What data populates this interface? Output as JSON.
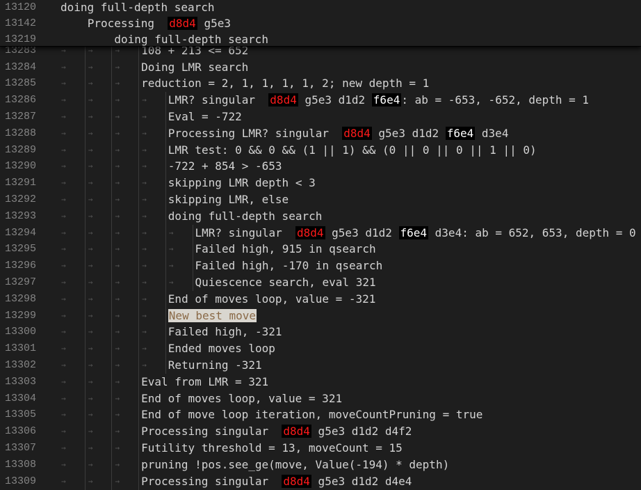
{
  "sticky_lines": [
    {
      "num": "13120",
      "indent": 0,
      "parts": [
        {
          "t": "doing full-depth search"
        }
      ]
    },
    {
      "num": "13142",
      "indent": 1,
      "parts": [
        {
          "t": "Processing  "
        },
        {
          "t": "d8d4",
          "s": "red"
        },
        {
          "t": " g5e3"
        }
      ]
    },
    {
      "num": "13219",
      "indent": 2,
      "parts": [
        {
          "t": "doing full-depth search"
        }
      ]
    }
  ],
  "partial_line": {
    "num": "13283",
    "indent": 3,
    "text": "108 + 213 <= 652"
  },
  "lines": [
    {
      "num": "13284",
      "indent": 3,
      "parts": [
        {
          "t": "Doing LMR search"
        }
      ]
    },
    {
      "num": "13285",
      "indent": 3,
      "parts": [
        {
          "t": "reduction = 2, 1, 1, 1, 1, 2; new depth = 1"
        }
      ]
    },
    {
      "num": "13286",
      "indent": 4,
      "parts": [
        {
          "t": "LMR? singular  "
        },
        {
          "t": "d8d4",
          "s": "red"
        },
        {
          "t": " g5e3 d1d2 "
        },
        {
          "t": "f6e4",
          "s": "white"
        },
        {
          "t": ": ab = -653, -652, depth = 1"
        }
      ]
    },
    {
      "num": "13287",
      "indent": 4,
      "parts": [
        {
          "t": "Eval = -722"
        }
      ]
    },
    {
      "num": "13288",
      "indent": 4,
      "parts": [
        {
          "t": "Processing LMR? singular  "
        },
        {
          "t": "d8d4",
          "s": "red"
        },
        {
          "t": " g5e3 d1d2 "
        },
        {
          "t": "f6e4",
          "s": "white"
        },
        {
          "t": " d3e4"
        }
      ]
    },
    {
      "num": "13289",
      "indent": 4,
      "parts": [
        {
          "t": "LMR test: 0 && 0 && (1 || 1) && (0 || 0 || 0 || 1 || 0)"
        }
      ]
    },
    {
      "num": "13290",
      "indent": 4,
      "parts": [
        {
          "t": "-722 + 854 > -653"
        }
      ]
    },
    {
      "num": "13291",
      "indent": 4,
      "parts": [
        {
          "t": "skipping LMR depth < 3"
        }
      ]
    },
    {
      "num": "13292",
      "indent": 4,
      "parts": [
        {
          "t": "skipping LMR, else"
        }
      ]
    },
    {
      "num": "13293",
      "indent": 4,
      "parts": [
        {
          "t": "doing full-depth search"
        }
      ]
    },
    {
      "num": "13294",
      "indent": 5,
      "parts": [
        {
          "t": "LMR? singular  "
        },
        {
          "t": "d8d4",
          "s": "red"
        },
        {
          "t": " g5e3 d1d2 "
        },
        {
          "t": "f6e4",
          "s": "white"
        },
        {
          "t": " d3e4: ab = 652, 653, depth = 0"
        }
      ]
    },
    {
      "num": "13295",
      "indent": 5,
      "parts": [
        {
          "t": "Failed high, 915 in qsearch"
        }
      ]
    },
    {
      "num": "13296",
      "indent": 5,
      "parts": [
        {
          "t": "Failed high, -170 in qsearch"
        }
      ]
    },
    {
      "num": "13297",
      "indent": 5,
      "parts": [
        {
          "t": "Quiescence search, eval 321"
        }
      ]
    },
    {
      "num": "13298",
      "indent": 4,
      "parts": [
        {
          "t": "End of moves loop, value = -321"
        }
      ]
    },
    {
      "num": "13299",
      "indent": 4,
      "parts": [
        {
          "t": "New best move",
          "s": "hl"
        }
      ]
    },
    {
      "num": "13300",
      "indent": 4,
      "parts": [
        {
          "t": "Failed high, -321"
        }
      ]
    },
    {
      "num": "13301",
      "indent": 4,
      "parts": [
        {
          "t": "Ended moves loop"
        }
      ]
    },
    {
      "num": "13302",
      "indent": 4,
      "parts": [
        {
          "t": "Returning -321"
        }
      ]
    },
    {
      "num": "13303",
      "indent": 3,
      "parts": [
        {
          "t": "Eval from LMR = 321"
        }
      ]
    },
    {
      "num": "13304",
      "indent": 3,
      "parts": [
        {
          "t": "End of moves loop, value = 321"
        }
      ]
    },
    {
      "num": "13305",
      "indent": 3,
      "parts": [
        {
          "t": "End of move loop iteration, moveCountPruning = true"
        }
      ]
    },
    {
      "num": "13306",
      "indent": 3,
      "parts": [
        {
          "t": "Processing singular  "
        },
        {
          "t": "d8d4",
          "s": "red"
        },
        {
          "t": " g5e3 d1d2 d4f2"
        }
      ]
    },
    {
      "num": "13307",
      "indent": 3,
      "parts": [
        {
          "t": "Futility threshold = 13, moveCount = 15"
        }
      ]
    },
    {
      "num": "13308",
      "indent": 3,
      "parts": [
        {
          "t": "pruning !pos.see_ge(move, Value(-194) * depth)"
        }
      ]
    },
    {
      "num": "13309",
      "indent": 3,
      "parts": [
        {
          "t": "Processing singular  "
        },
        {
          "t": "d8d4",
          "s": "red"
        },
        {
          "t": " g5e3 d1d2 d4e4"
        }
      ]
    }
  ]
}
